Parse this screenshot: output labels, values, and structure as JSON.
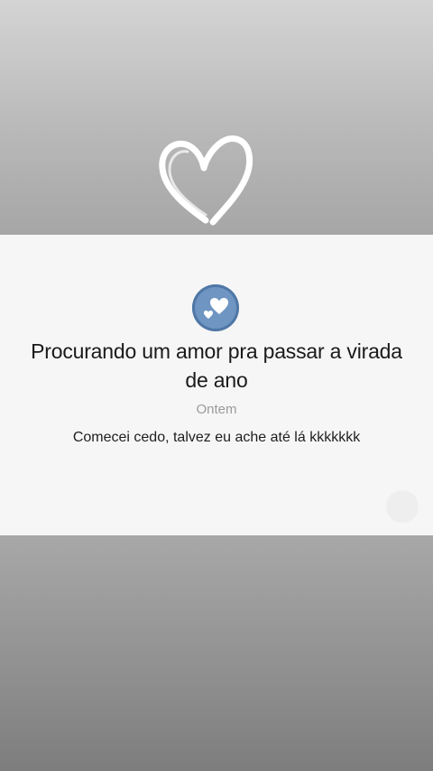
{
  "post": {
    "title": "Procurando um amor pra passar a virada de ano",
    "timestamp": "Ontem",
    "message": "Comecei cedo, talvez eu ache até lá kkkkkkk"
  },
  "icons": {
    "decoration": "heart-outline-icon",
    "avatar": "hearts-icon",
    "action": "circle-button-icon"
  },
  "colors": {
    "avatar_bg": "#6f95c2",
    "card_bg": "#f6f6f6",
    "heart_stroke": "#ffffff"
  }
}
